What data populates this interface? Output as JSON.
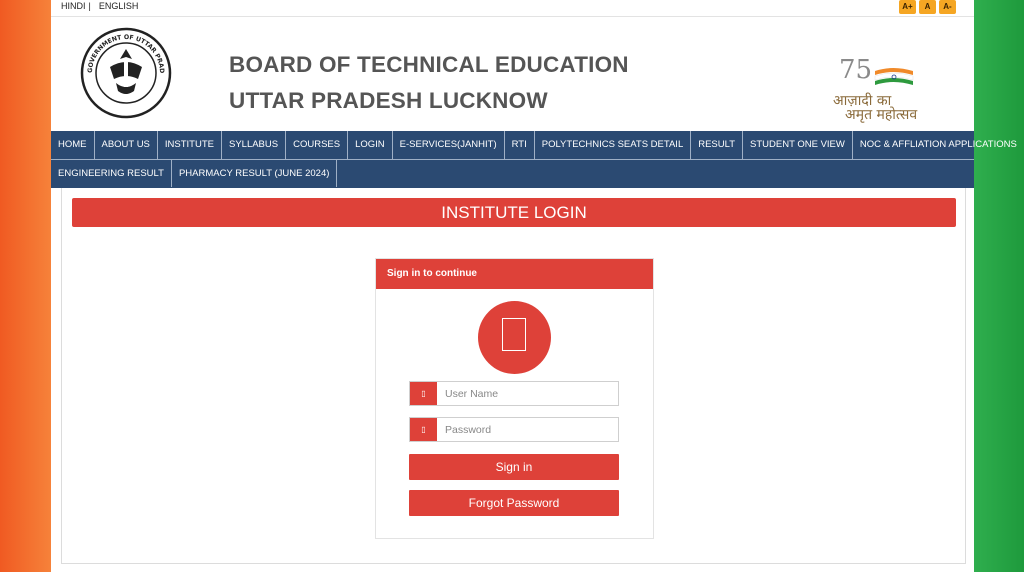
{
  "topbar": {
    "lang_hindi": "HINDI",
    "lang_sep": "|",
    "lang_english": "ENGLISH",
    "font_increase": "A+",
    "font_normal": "A",
    "font_decrease": "A-"
  },
  "header": {
    "title_line1": "BOARD OF TECHNICAL EDUCATION",
    "title_line2": "UTTAR PRADESH LUCKNOW",
    "emblem_text": "GOVERNMENT OF UTTAR PRADESH",
    "azadi_number": "75",
    "azadi_line1": "आज़ादी का",
    "azadi_line2": "अमृत महोत्सव"
  },
  "nav": {
    "row1": [
      "HOME",
      "ABOUT US",
      "INSTITUTE",
      "SYLLABUS",
      "COURSES",
      "LOGIN",
      "E-SERVICES(JANHIT)",
      "RTI",
      "POLYTECHNICS SEATS DETAIL",
      "RESULT",
      "STUDENT ONE VIEW",
      "NOC & AFFLIATION APPLICATIONS"
    ],
    "row2": [
      "ENGINEERING RESULT",
      "PHARMACY RESULT (JUNE 2024)"
    ]
  },
  "main": {
    "banner_title": "INSTITUTE LOGIN",
    "card_title": "Sign in to continue",
    "username_placeholder": "User Name",
    "password_placeholder": "Password",
    "signin_label": "Sign in",
    "forgot_label": "Forgot Password",
    "field_icon_glyph": "▯"
  },
  "colors": {
    "accent_red": "#de4139",
    "nav_blue": "#2b4a72",
    "saffron": "#f05a22",
    "green": "#1e9a3c"
  }
}
